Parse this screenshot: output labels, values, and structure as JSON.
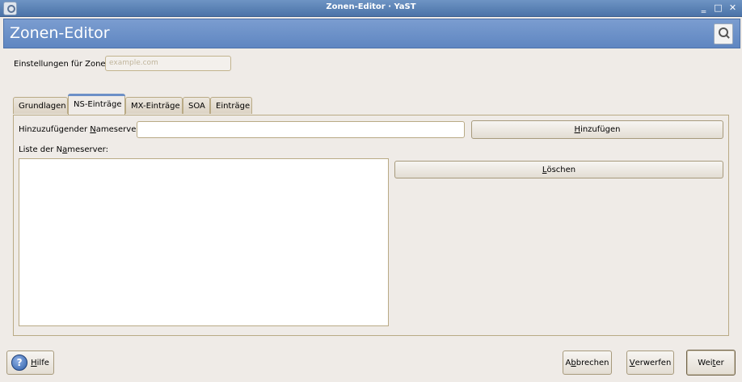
{
  "window": {
    "title": "Zonen-Editor · YaST",
    "minimize_glyph": "‗",
    "maximize_glyph": "□",
    "close_glyph": "✕"
  },
  "header": {
    "title": "Zonen-Editor",
    "icon": "search-document-icon"
  },
  "zone": {
    "label": "Einstellungen für Zone",
    "value": "example.com"
  },
  "tabs": [
    {
      "label": "Grundlagen"
    },
    {
      "label": "NS-Einträge"
    },
    {
      "label": "MX-Einträge"
    },
    {
      "label": "SOA"
    },
    {
      "label": "Einträge"
    }
  ],
  "ns": {
    "add_label_pre": "Hinzuzufügender ",
    "add_label_mnemonic": "N",
    "add_label_post": "ameserver:",
    "add_input_value": "",
    "add_button_pre": "",
    "add_button_mnemonic": "H",
    "add_button_post": "inzufügen",
    "list_label_pre": "Liste der N",
    "list_label_mnemonic": "a",
    "list_label_post": "meserver:",
    "delete_button_pre": "",
    "delete_button_mnemonic": "L",
    "delete_button_post": "öschen"
  },
  "footer": {
    "help_icon_glyph": "?",
    "help_pre": "",
    "help_mnemonic": "H",
    "help_post": "ilfe",
    "cancel_pre": "A",
    "cancel_mnemonic": "b",
    "cancel_post": "brechen",
    "discard_pre": "",
    "discard_mnemonic": "V",
    "discard_post": "erwerfen",
    "next_pre": "Wei",
    "next_mnemonic": "t",
    "next_post": "er"
  }
}
